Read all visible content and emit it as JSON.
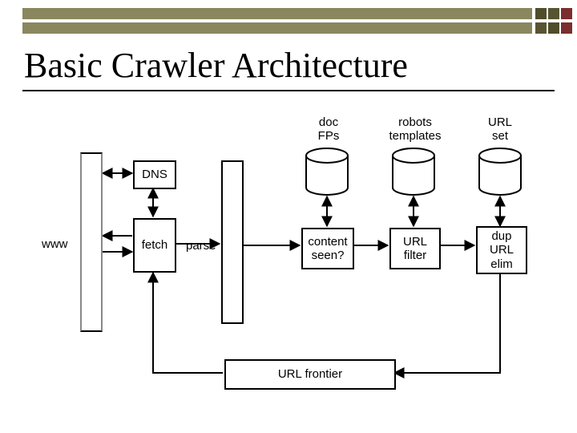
{
  "title": "Basic Crawler Architecture",
  "labels": {
    "www": "www",
    "dns": "DNS",
    "fetch": "fetch",
    "parse": "parse",
    "content_seen": "content\nseen?",
    "url_filter": "URL\nfilter",
    "dup_url_elim": "dup\nURL\nelim",
    "frontier": "URL frontier",
    "store_doc": "doc\nFPs",
    "store_robots": "robots\ntemplates",
    "store_urlset": "URL\nset"
  },
  "diagram": {
    "nodes": [
      {
        "id": "www",
        "type": "tall-box",
        "label": "www"
      },
      {
        "id": "dns",
        "type": "box",
        "label": "DNS"
      },
      {
        "id": "fetch",
        "type": "box",
        "label": "fetch"
      },
      {
        "id": "parse",
        "type": "tall-box",
        "label": "parse"
      },
      {
        "id": "content_seen",
        "type": "box",
        "label": "content seen?"
      },
      {
        "id": "url_filter",
        "type": "box",
        "label": "URL filter"
      },
      {
        "id": "dup_url_elim",
        "type": "box",
        "label": "dup URL elim"
      },
      {
        "id": "frontier",
        "type": "box",
        "label": "URL frontier"
      },
      {
        "id": "doc_fps",
        "type": "cylinder",
        "label": "doc FPs"
      },
      {
        "id": "robots",
        "type": "cylinder",
        "label": "robots templates"
      },
      {
        "id": "url_set",
        "type": "cylinder",
        "label": "URL set"
      }
    ],
    "edges": [
      {
        "from": "www",
        "to": "dns",
        "dir": "both"
      },
      {
        "from": "dns",
        "to": "fetch",
        "dir": "both"
      },
      {
        "from": "www",
        "to": "fetch",
        "dir": "both"
      },
      {
        "from": "fetch",
        "to": "parse",
        "dir": "forward"
      },
      {
        "from": "parse",
        "to": "content_seen",
        "dir": "forward"
      },
      {
        "from": "content_seen",
        "to": "url_filter",
        "dir": "forward"
      },
      {
        "from": "url_filter",
        "to": "dup_url_elim",
        "dir": "forward"
      },
      {
        "from": "content_seen",
        "to": "doc_fps",
        "dir": "both"
      },
      {
        "from": "url_filter",
        "to": "robots",
        "dir": "both"
      },
      {
        "from": "dup_url_elim",
        "to": "url_set",
        "dir": "both"
      },
      {
        "from": "dup_url_elim",
        "to": "frontier",
        "dir": "forward"
      },
      {
        "from": "frontier",
        "to": "fetch",
        "dir": "forward"
      }
    ]
  }
}
